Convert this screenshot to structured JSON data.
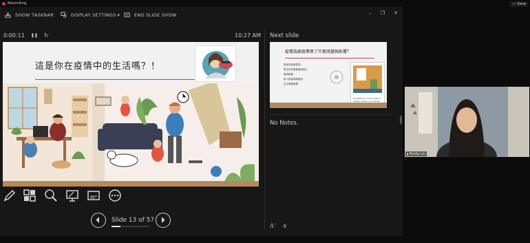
{
  "recording": {
    "label": "Recording"
  },
  "view_button": {
    "label": "View"
  },
  "toolbar": {
    "show_taskbar": "SHOW TASKBAR",
    "display_settings": "DISPLAY SETTINGS",
    "display_settings_caret": "▾",
    "end_slide_show": "END SLIDE SHOW"
  },
  "window_controls": {
    "minimize": "–",
    "restore": "❐",
    "close": "✕"
  },
  "timer": {
    "elapsed": "0:00:11",
    "pause_icon": "❚❚",
    "reset_icon": "↻"
  },
  "clock": {
    "time": "10:27 AM"
  },
  "next_slide": {
    "label": "Next slide",
    "title": "疫情為家庭帶來了什麼改變與影響？",
    "bullets": [
      "居家防疫新型態",
      "學生的作業都變成線上",
      "經濟衝擊",
      "家人相處時間增加",
      "自主健康管理"
    ],
    "card_caption": "Sometimes, it's the best to simply pursue your family health and peace."
  },
  "current_slide": {
    "title": "這是你在疫情中的生活嗎？！"
  },
  "notes": {
    "text": "No Notes."
  },
  "tools": {
    "pen": "pen-icon",
    "all_slides": "see-all-slides-icon",
    "zoom": "zoom-icon",
    "laser": "pointer-options-icon",
    "subtitles": "subtitles-icon",
    "more": "more-options-icon"
  },
  "navigation": {
    "counter": "Slide 13 of 57",
    "current": 13,
    "total": 57,
    "progress_fraction": 0.228
  },
  "font_controls": {
    "increase": "A",
    "decrease": "A"
  },
  "webcam": {
    "name": "Emily Lin"
  },
  "colors": {
    "accent_rule": "#c24455",
    "record_dot": "#e23b2e",
    "background": "#171717"
  }
}
